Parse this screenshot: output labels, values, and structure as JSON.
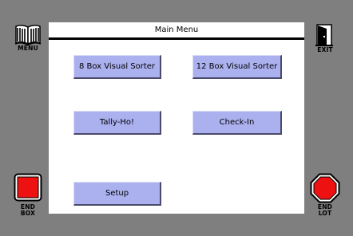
{
  "sidebar": {
    "menu_label": "MENU",
    "menu_icon": "book-icon",
    "exit_label": "EXIT",
    "exit_icon": "door-exit-icon",
    "end_box_line1": "END",
    "end_box_line2": "BOX",
    "end_box_icon": "red-square-stop-icon",
    "end_lot_line1": "END",
    "end_lot_line2": "LOT",
    "end_lot_icon": "red-octagon-stop-icon"
  },
  "main": {
    "title": "Main Menu",
    "buttons": [
      {
        "label": "8 Box Visual Sorter"
      },
      {
        "label": "12 Box Visual Sorter"
      },
      {
        "label": "Tally-Ho!"
      },
      {
        "label": "Check-In"
      },
      {
        "label": "Setup"
      }
    ]
  },
  "colors": {
    "background": "#7f7f7f",
    "panel": "#ffffff",
    "button": "#abb0ef",
    "stop_red": "#ee1111"
  }
}
